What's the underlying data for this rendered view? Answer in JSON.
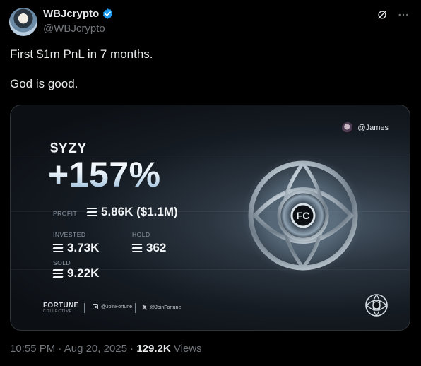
{
  "tweet": {
    "display_name": "WBJcrypto",
    "handle": "@WBJcrypto",
    "text": "First $1m PnL in 7 months.\n\nGod is good.",
    "time": "10:55 PM",
    "date": "Aug 20, 2025",
    "dot": "·",
    "views_count": "129.2K",
    "views_label": "Views",
    "verified_color": "#1d9bf0"
  },
  "card": {
    "user": "@James",
    "ticker": "$YZY",
    "change": "+157%",
    "profit_label": "PROFIT",
    "profit_value": "5.86K ($1.1M)",
    "invested_label": "INVESTED",
    "invested_value": "3.73K",
    "hold_label": "HOLD",
    "hold_value": "362",
    "sold_label": "SOLD",
    "sold_value": "9.22K",
    "brand_name": "FORTUNE",
    "brand_sub": "COLLECTIVE",
    "instagram": "@JoinFortune",
    "x_handle": "@JoinFortune"
  },
  "icons": [
    "verified-badge-icon",
    "grok-icon",
    "more-icon",
    "solana-icon",
    "instagram-icon",
    "x-icon",
    "fortune-eye-logo",
    "fortune-small-logo"
  ]
}
